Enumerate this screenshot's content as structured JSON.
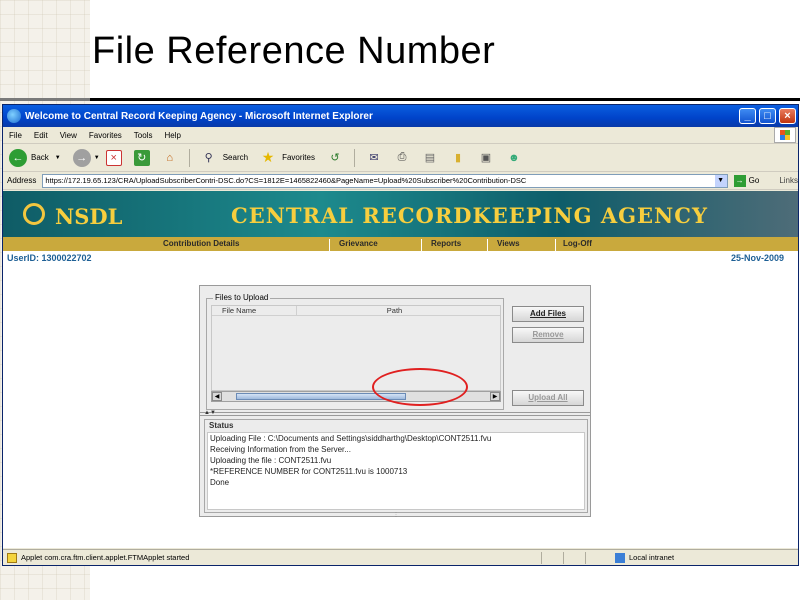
{
  "slide": {
    "title": "File Reference Number"
  },
  "window": {
    "title": "Welcome to Central Record Keeping Agency - Microsoft Internet Explorer",
    "controls": {
      "minimize": "_",
      "maximize": "□",
      "close": "×"
    }
  },
  "menubar": {
    "items": [
      "File",
      "Edit",
      "View",
      "Favorites",
      "Tools",
      "Help"
    ]
  },
  "toolbar": {
    "back_label": "Back",
    "search_label": "Search",
    "favorites_label": "Favorites"
  },
  "addressbar": {
    "label": "Address",
    "url": "https://172.19.65.123/CRA/UploadSubscriberContri-DSC.do?CS=1812E=1465822460&PageName=Upload%20Subscriber%20Contribution-DSC",
    "go_label": "Go",
    "links_label": "Links"
  },
  "site": {
    "brand": "NSDL",
    "agency": "CENTRAL RECORDKEEPING AGENCY",
    "nav": [
      "Contribution Details",
      "Grievance",
      "Reports",
      "Views",
      "Log-Off"
    ],
    "user_id": "UserID: 1300022702",
    "date": "25-Nov-2009"
  },
  "applet": {
    "files_legend": "Files to Upload",
    "columns": [
      "File Name",
      "Path"
    ],
    "buttons": {
      "add_files": "Add Files",
      "remove": "Remove",
      "upload_all": "Upload All"
    },
    "status_legend": "Status",
    "status_lines": [
      "Uploading File : C:\\Documents and Settings\\siddharthg\\Desktop\\CONT2511.fvu",
      "Receiving Information from the Server...",
      "Uploading the file : CONT2511.fvu",
      "*REFERENCE NUMBER for CONT2511.fvu is 1000713",
      "Done"
    ]
  },
  "statusbar": {
    "text": "Applet com.cra.ftm.client.applet.FTMApplet started",
    "zone": "Local intranet"
  },
  "colors": {
    "title_bar": "#0a5ee0",
    "banner": "#1d8a8d",
    "banner_text": "#f7ce3e",
    "nav_bar": "#c9a93d",
    "user_text": "#1d5f95",
    "highlight": "#e02020"
  }
}
